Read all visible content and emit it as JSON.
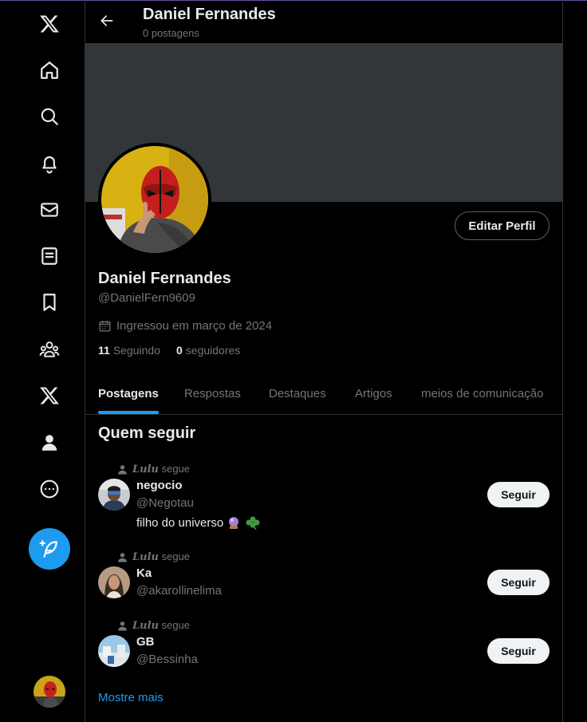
{
  "sidebar": {
    "items": [
      {
        "name": "x-logo",
        "icon": "x-logo-icon"
      },
      {
        "name": "home",
        "icon": "home-icon"
      },
      {
        "name": "explore",
        "icon": "search-icon"
      },
      {
        "name": "notifications",
        "icon": "bell-icon"
      },
      {
        "name": "messages",
        "icon": "mail-icon"
      },
      {
        "name": "lists",
        "icon": "list-icon"
      },
      {
        "name": "bookmarks",
        "icon": "bookmark-icon"
      },
      {
        "name": "communities",
        "icon": "communities-icon"
      },
      {
        "name": "premium",
        "icon": "x-logo-icon"
      },
      {
        "name": "profile",
        "icon": "person-icon"
      },
      {
        "name": "more",
        "icon": "more-circle-icon"
      }
    ],
    "compose_icon": "feather-plus-icon",
    "accent": "#1d9bf0"
  },
  "header": {
    "name": "Daniel Fernandes",
    "post_count": "0 postagens"
  },
  "profile": {
    "name": "Daniel Fernandes",
    "handle": "@DanielFern9609",
    "joined": "Ingressou em março de 2024",
    "following_count": "11",
    "following_label": "Seguindo",
    "followers_count": "0",
    "followers_label": "seguidores",
    "edit_label": "Editar Perfil"
  },
  "tabs": [
    {
      "label": "Postagens",
      "active": true
    },
    {
      "label": "Respostas",
      "active": false
    },
    {
      "label": "Destaques",
      "active": false
    },
    {
      "label": "Artigos",
      "active": false
    },
    {
      "label": "meios de comunicação",
      "active": false
    }
  ],
  "who_to_follow": {
    "title": "Quem seguir",
    "suggestions": [
      {
        "context_user": "Lulu",
        "context_text": "segue",
        "name": "negocio",
        "handle": "@Negotau",
        "bio": "filho do universo",
        "follow_label": "Seguir"
      },
      {
        "context_user": "Lulu",
        "context_text": "segue",
        "name": "Ka",
        "handle": "@akarollinelima",
        "bio": "",
        "follow_label": "Seguir"
      },
      {
        "context_user": "Lulu",
        "context_text": "segue",
        "name": "GB",
        "handle": "@Bessinha",
        "bio": "",
        "follow_label": "Seguir"
      }
    ],
    "show_more": "Mostre mais"
  }
}
